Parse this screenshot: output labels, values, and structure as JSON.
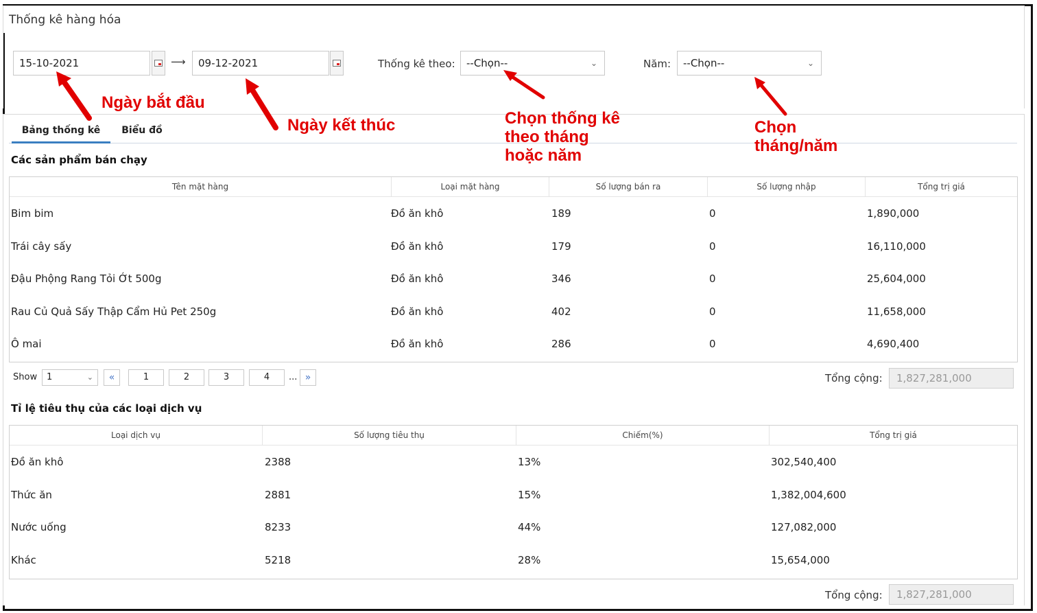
{
  "window": {
    "title": "Thống kê hàng hóa"
  },
  "filters": {
    "start_date": "15-10-2021",
    "end_date": "09-12-2021",
    "arrow": "⟶",
    "stat_by_label": "Thống kê theo:",
    "stat_by_value": "--Chọn--",
    "year_label": "Năm:",
    "year_value": "--Chọn--"
  },
  "annotations": {
    "start": "Ngày bắt đầu",
    "end": "Ngày kết thúc",
    "statby_l1": "Chọn thống kê",
    "statby_l2": "theo tháng",
    "statby_l3": "hoặc năm",
    "year_l1": "Chọn",
    "year_l2": "tháng/năm",
    "color": "#e10000"
  },
  "tabs": [
    {
      "label": "Bảng thống kê",
      "active": true
    },
    {
      "label": "Biểu đồ",
      "active": false
    }
  ],
  "bestsellers": {
    "title": "Các sản phẩm bán chạy",
    "columns": [
      "Tên mặt hàng",
      "Loại mặt hàng",
      "Số lượng bán ra",
      "Số lượng nhập",
      "Tổng trị giá"
    ],
    "rows": [
      [
        "Bim bim",
        "Đồ ăn khô",
        "189",
        "0",
        "1,890,000"
      ],
      [
        "Trái cây sấy",
        "Đồ ăn khô",
        "179",
        "0",
        "16,110,000"
      ],
      [
        "Đậu Phộng Rang Tỏi Ớt 500g",
        "Đồ ăn khô",
        "346",
        "0",
        "25,604,000"
      ],
      [
        "Rau Củ Quả Sấy Thập Cẩm Hủ Pet 250g",
        "Đồ ăn khô",
        "402",
        "0",
        "11,658,000"
      ],
      [
        "Ô mai",
        "Đồ ăn khô",
        "286",
        "0",
        "4,690,400"
      ]
    ],
    "pager": {
      "show_label": "Show",
      "show_value": "1",
      "first": "«",
      "pages": [
        "1",
        "2",
        "3",
        "4"
      ],
      "ellipsis": "...",
      "last": "»"
    },
    "total_label": "Tổng cộng:",
    "total_value": "1,827,281,000"
  },
  "services": {
    "title": "Tỉ lệ tiêu thụ của các loại dịch vụ",
    "columns": [
      "Loại dịch vụ",
      "Số lượng tiêu thụ",
      "Chiếm(%)",
      "Tổng trị giá"
    ],
    "rows": [
      [
        "Đồ ăn khô",
        "2388",
        "13%",
        "302,540,400"
      ],
      [
        "Thức ăn",
        "2881",
        "15%",
        "1,382,004,600"
      ],
      [
        "Nước uống",
        "8233",
        "44%",
        "127,082,000"
      ],
      [
        "Khác",
        "5218",
        "28%",
        "15,654,000"
      ]
    ],
    "total_label": "Tổng cộng:",
    "total_value": "1,827,281,000"
  }
}
